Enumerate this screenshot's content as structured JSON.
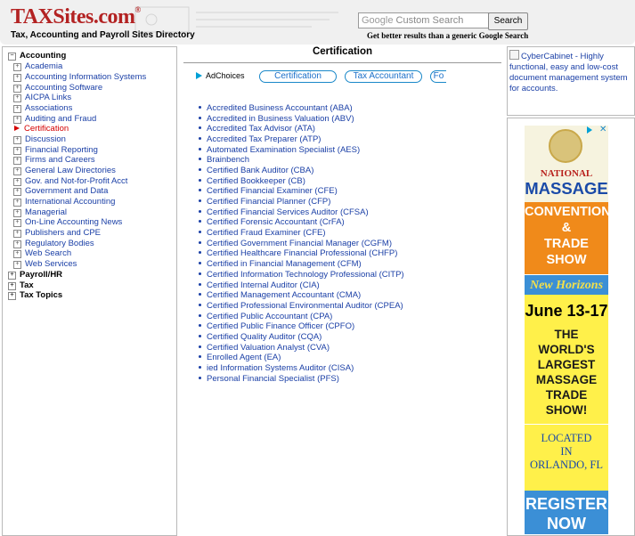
{
  "header": {
    "logo_main": "TAXSites.com",
    "logo_reg": "®",
    "tagline": "Tax, Accounting and Payroll Sites Directory",
    "search_brand": "Google",
    "search_placeholder": "Custom Search",
    "search_button": "Search",
    "search_note": "Get better results than a generic Google Search"
  },
  "nav": {
    "top_items": [
      {
        "label": "Accounting",
        "expanded": true
      },
      {
        "label": "Payroll/HR",
        "expanded": false
      },
      {
        "label": "Tax",
        "expanded": false
      },
      {
        "label": "Tax Topics",
        "expanded": false
      }
    ],
    "accounting_children": [
      "Academia",
      "Accounting Information Systems",
      "Accounting Software",
      "AICPA Links",
      "Associations",
      "Auditing and Fraud",
      "Certification",
      "Discussion",
      "Financial Reporting",
      "Firms and Careers",
      "General Law Directories",
      "Gov. and Not-for-Profit Acct",
      "Government and Data",
      "International Accounting",
      "Managerial",
      "On-Line Accounting News",
      "Publishers and CPE",
      "Regulatory Bodies",
      "Web Search",
      "Web Services"
    ],
    "active_child": "Certification",
    "expand_glyph": "+",
    "collapse_glyph": "−"
  },
  "main": {
    "title": "Certification",
    "adchoices": "AdChoices",
    "ad_links": [
      "Certification",
      "Tax Accountant",
      "Fo"
    ],
    "items": [
      "Accredited Business Accountant (ABA)",
      "Accredited in Business Valuation (ABV)",
      "Accredited Tax Advisor (ATA)",
      "Accredited Tax Preparer (ATP)",
      "Automated Examination Specialist (AES)",
      "Brainbench",
      "Certified Bank Auditor (CBA)",
      "Certified Bookkeeper (CB)",
      "Certified Financial Examiner (CFE)",
      "Certified Financial Planner (CFP)",
      "Certified Financial Services Auditor (CFSA)",
      "Certified Forensic Accountant (CrFA)",
      "Certified Fraud Examiner (CFE)",
      "Certified Government Financial Manager (CGFM)",
      "Certified Healthcare Financial Professional (CHFP)",
      "Certified in Financial Management (CFM)",
      "Certified Information Technology Professional (CITP)",
      "Certified Internal Auditor (CIA)",
      "Certified Management Accountant (CMA)",
      "Certified Professional Environmental Auditor (CPEA)",
      "Certified Public Accountant (CPA)",
      "Certified Public Finance Officer (CPFO)",
      "Certified Quality Auditor (CQA)",
      "Certified Valuation Analyst (CVA)",
      "Enrolled Agent (EA)",
      "ied Information Systems Auditor (CISA)",
      "Personal Financial Specialist (PFS)"
    ]
  },
  "right": {
    "cyber_ad": "CyberCabinet - Highly functional, easy and low-cost document management system for accounts.",
    "ad_close": "✕",
    "banner": {
      "national": "NATIONAL",
      "massage": "MASSAGE",
      "convention": "CONVENTION",
      "amp": "&",
      "trade": "TRADE",
      "show": "SHOW",
      "new_horizons": "New Horizons",
      "dates": "June 13-17",
      "the": "THE",
      "worlds": "WORLD'S",
      "largest": "LARGEST",
      "massage2": "MASSAGE",
      "tradeshow": "TRADE SHOW!",
      "located": "LOCATED",
      "in": "IN",
      "city": "ORLANDO, FL",
      "register": "REGISTER",
      "now": "NOW"
    }
  },
  "colors": {
    "link": "#1a3fa6",
    "active": "#d40000",
    "logo": "#b32222"
  }
}
